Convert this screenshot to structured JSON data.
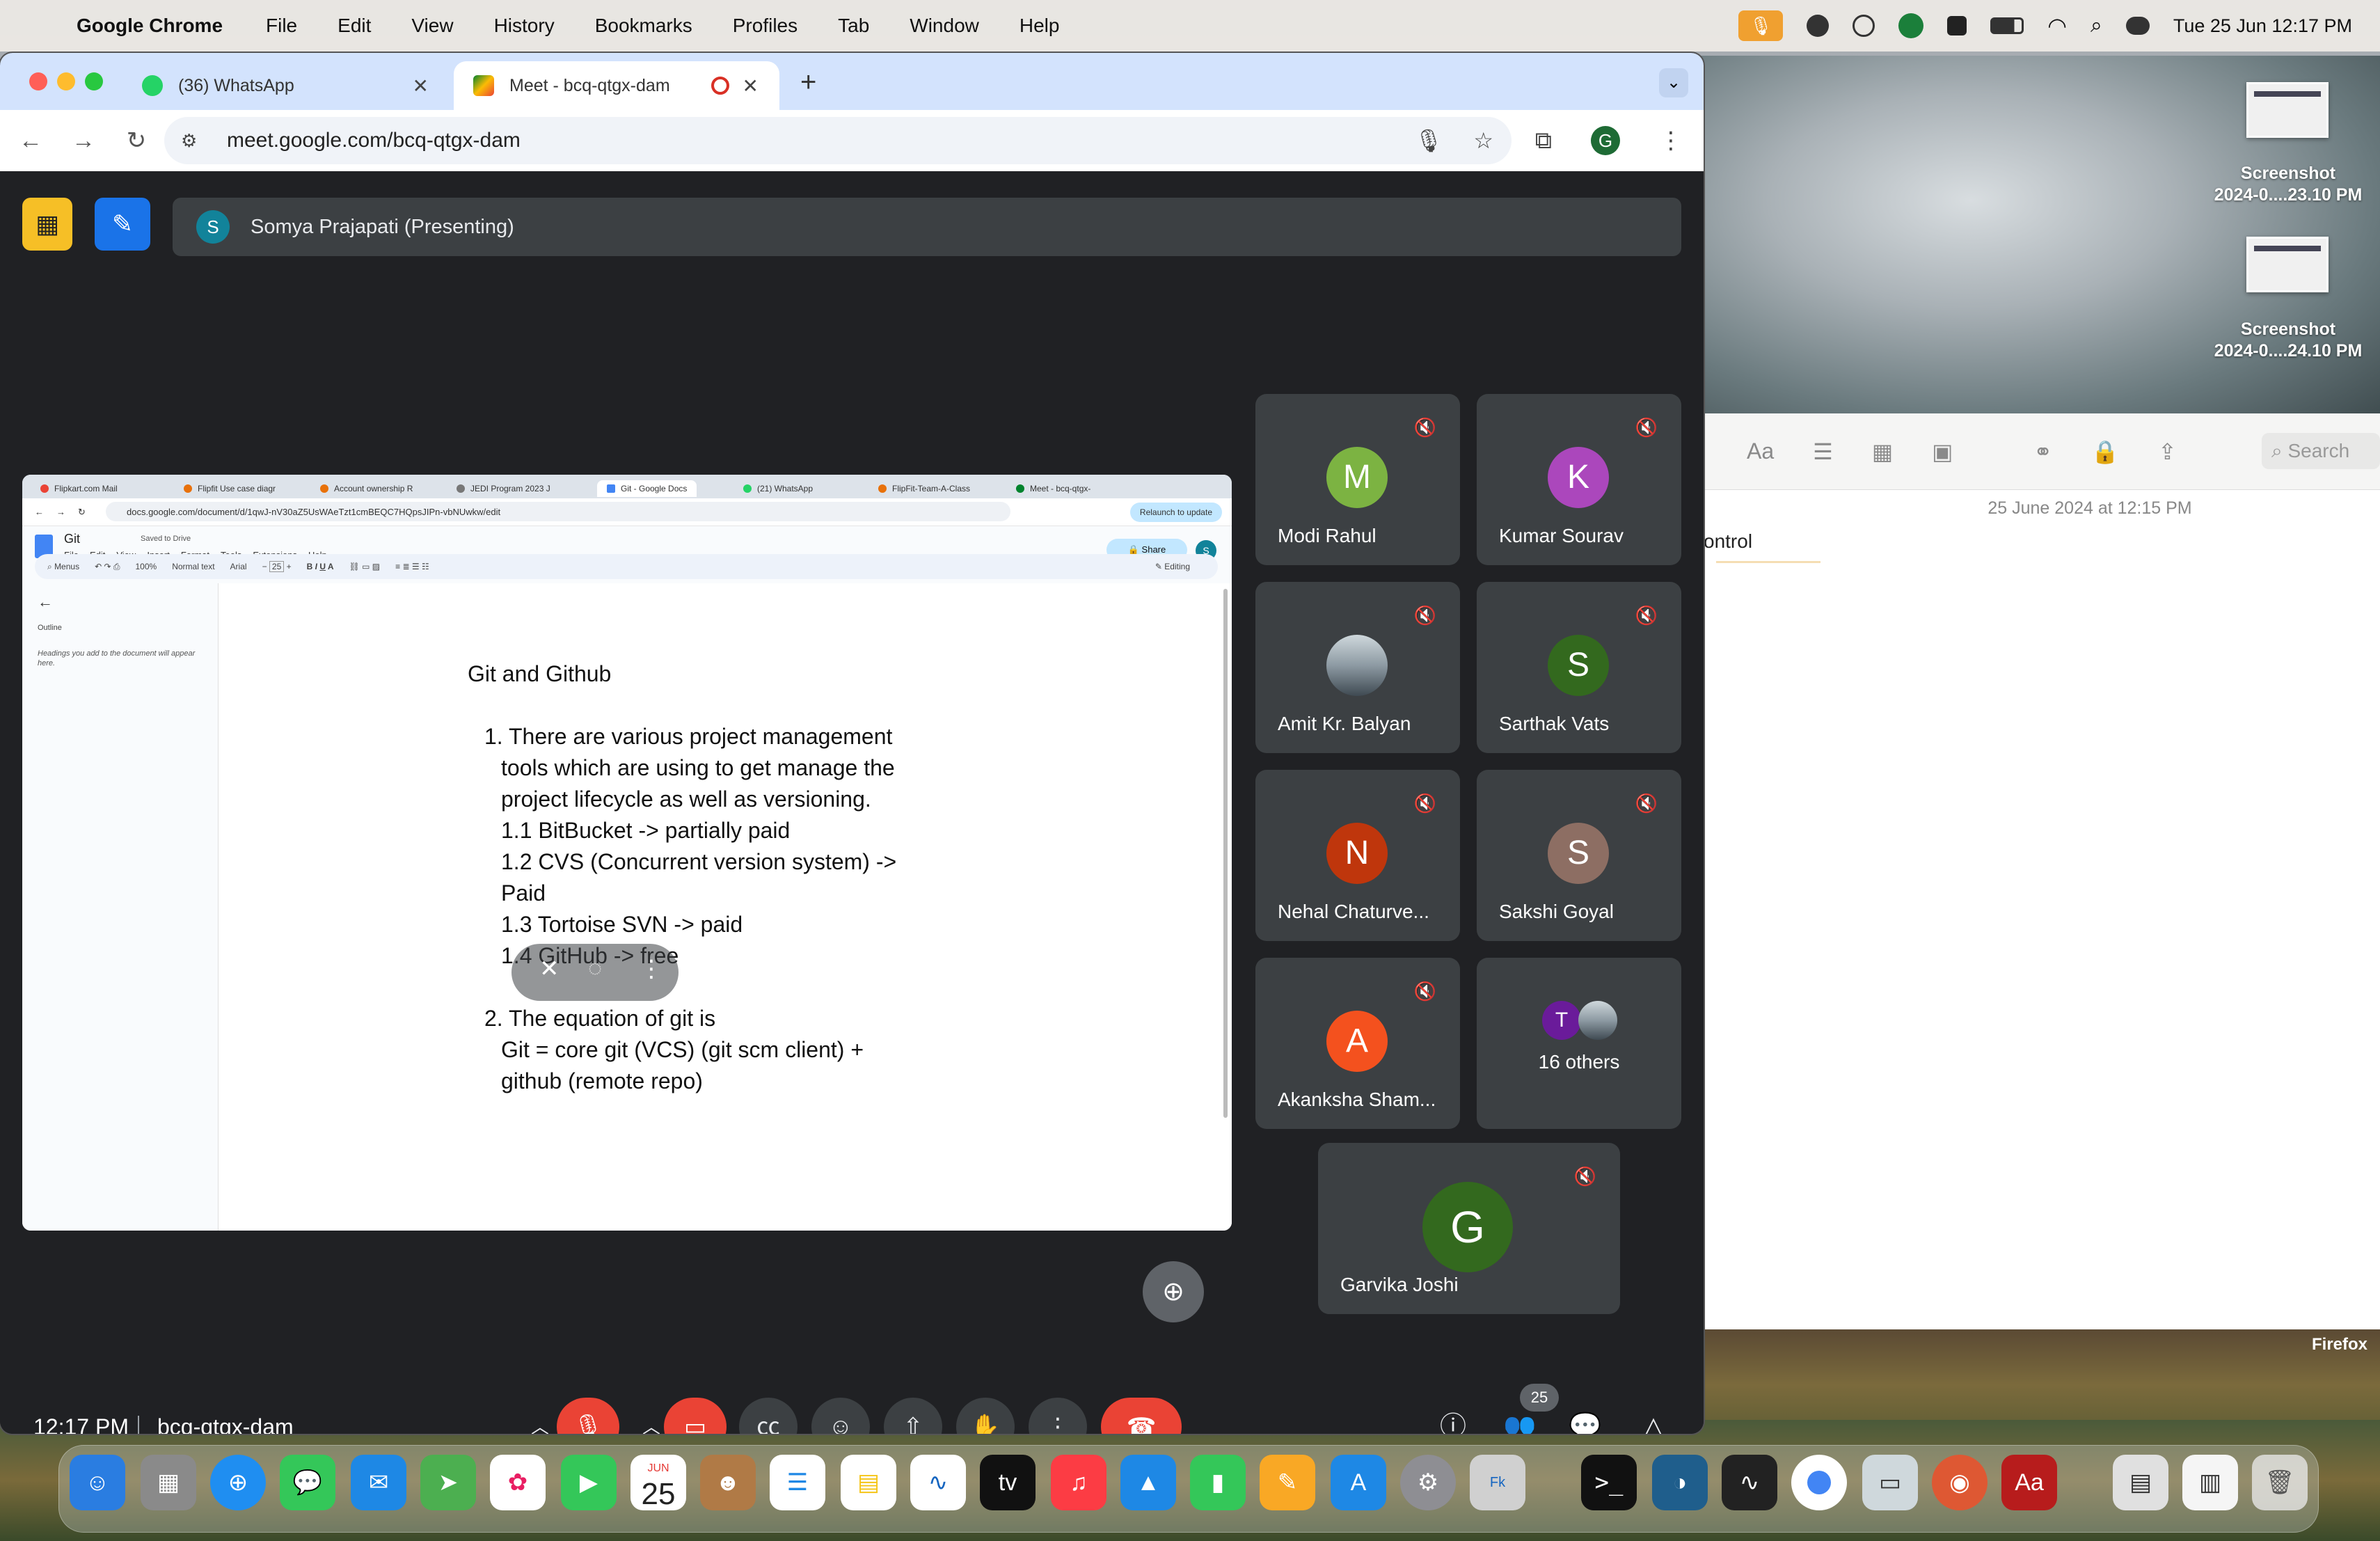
{
  "menubar": {
    "app": "Google Chrome",
    "items": [
      "File",
      "Edit",
      "View",
      "History",
      "Bookmarks",
      "Profiles",
      "Tab",
      "Window",
      "Help"
    ],
    "clock": "Tue 25 Jun  12:17 PM"
  },
  "browser": {
    "tabs": [
      {
        "label": "(36) WhatsApp"
      },
      {
        "label": "Meet - bcq-qtgx-dam"
      }
    ],
    "url": "meet.google.com/bcq-qtgx-dam",
    "profile_initial": "G"
  },
  "meet": {
    "presenter": "Somya Prajapati (Presenting)",
    "presenter_initial": "S",
    "time": "12:17 PM",
    "code": "bcq-qtgx-dam",
    "participants_count": "25",
    "participants": [
      {
        "name": "Modi Rahul",
        "initial": "M",
        "color": "#7cb342"
      },
      {
        "name": "Kumar Sourav",
        "initial": "K",
        "color": "#ab47bc"
      },
      {
        "name": "Amit Kr. Balyan",
        "initial": "",
        "color": "#90a4ae"
      },
      {
        "name": "Sarthak Vats",
        "initial": "S",
        "color": "#33691e"
      },
      {
        "name": "Nehal Chaturve...",
        "initial": "N",
        "color": "#bf360c"
      },
      {
        "name": "Sakshi Goyal",
        "initial": "S",
        "color": "#8d6e63"
      },
      {
        "name": "Akanksha Sham...",
        "initial": "A",
        "color": "#f4511e"
      },
      {
        "name": "16 others",
        "initial": "T",
        "color": "#6a1b9a"
      },
      {
        "name": "Garvika Joshi",
        "initial": "G",
        "color": "#33691e"
      }
    ]
  },
  "shared": {
    "tabs": [
      "Flipkart.com Mail",
      "Flipfit Use case diagr",
      "Account ownership R",
      "JEDI Program 2023 J",
      "Git - Google Docs",
      "(21) WhatsApp",
      "FlipFit-Team-A-Class",
      "Meet - bcq-qtgx-"
    ],
    "url": "docs.google.com/document/d/1qwJ-nV30aZ5UsWAeTzt1cmBEQC7HQpsJIPn-vbNUwkw/edit",
    "relaunch": "Relaunch to update",
    "doc_title": "Git",
    "saved": "Saved to Drive",
    "menus": [
      "File",
      "Edit",
      "View",
      "Insert",
      "Format",
      "Tools",
      "Extensions",
      "Help"
    ],
    "share": "Share",
    "avatar": "S",
    "fmt": {
      "menus": "Menus",
      "zoom": "100%",
      "style": "Normal text",
      "font": "Arial",
      "size": "25",
      "mode": "Editing"
    },
    "outline": "Outline",
    "outline_hint": "Headings you add to the document will appear here.",
    "content": {
      "heading": "Git and Github",
      "item1": [
        "1.  There are various project management",
        "tools which are using to get manage the",
        "project lifecycle as well as versioning.",
        "1.1 BitBucket -> partially paid",
        "1.2 CVS (Concurrent version system) ->",
        "Paid",
        "1.3 Tortoise SVN -> paid",
        "1.4 GitHub ->  free"
      ],
      "item2": [
        "2.  The equation of git is",
        "Git = core git (VCS) (git scm client) +",
        "github (remote repo)"
      ]
    }
  },
  "notes": {
    "date": "25 June 2024 at 12:15 PM",
    "text": "ontrol",
    "search": "Search"
  },
  "desktop": {
    "shots": [
      "Screenshot\n2024-0....23.10 PM",
      "Screenshot\n2024-0....24.10 PM"
    ],
    "firefox": "Firefox",
    "calendar_month": "JUN",
    "calendar_day": "25"
  }
}
